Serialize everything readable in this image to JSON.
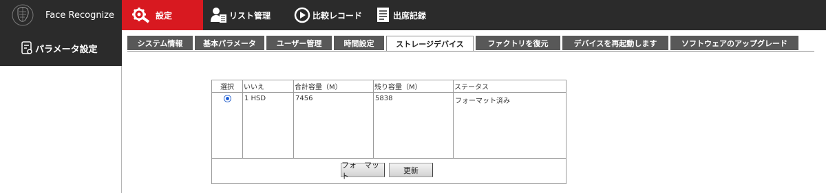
{
  "app": {
    "name": "Face Recognize"
  },
  "nav": [
    {
      "label": "設定",
      "icon": "gear-icon"
    },
    {
      "label": "リスト管理",
      "icon": "user-list-icon"
    },
    {
      "label": "比較レコード",
      "icon": "face-record-icon"
    },
    {
      "label": "出席記録",
      "icon": "attendance-icon"
    }
  ],
  "sidebar": {
    "label": "パラメータ設定",
    "icon": "parameter-icon"
  },
  "tabs": [
    "システム情報",
    "基本パラメータ",
    "ユーザー管理",
    "時間設定",
    "ストレージデバイス",
    "ファクトリを復元",
    "デバイスを再起動します",
    "ソフトウェアのアップグレード"
  ],
  "storage": {
    "headers": [
      "選択",
      "いいえ",
      "合計容量（M）",
      "残り容量（M）",
      "ステータス"
    ],
    "rows": [
      {
        "selected": true,
        "no": "1 HSD",
        "total": "7456",
        "remaining": "5838",
        "status": "フォーマット済み"
      }
    ],
    "buttons": {
      "format": "フォ　マット",
      "refresh": "更新"
    }
  },
  "colors": {
    "topbar": "#2b2b2b",
    "active": "#d81920",
    "tab": "#585858"
  }
}
